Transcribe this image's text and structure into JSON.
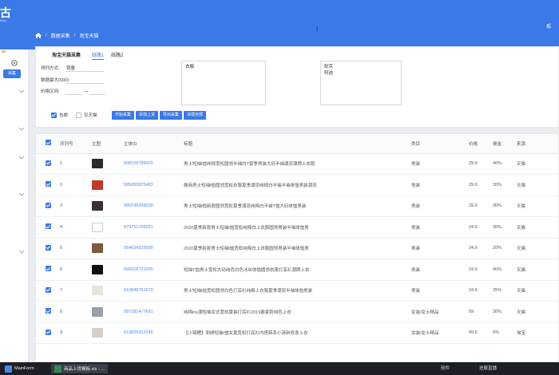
{
  "brand": {
    "logo": "古",
    "sub": "ding"
  },
  "top_right": "孤",
  "breadcrumb": [
    "数据采集",
    "淘宝天猫"
  ],
  "sidebar": {
    "active_label": "采集"
  },
  "tabs": {
    "main": "淘宝天猫采集",
    "t1": "线路1",
    "t2": "线路2"
  },
  "form": {
    "sort_label": "排列方式:",
    "sort_value": "销量",
    "max_label": "数据最大(500):",
    "price_label": "价格区间:",
    "price_sep": "—",
    "keywords": "衣服",
    "notes_line1": "耐克",
    "notes_line2": "阿迪"
  },
  "options": {
    "baoyou": "包邮",
    "tmall_only": "仅天猫"
  },
  "buttons": [
    "开始采集",
    "添加上货",
    "导出采集",
    "清理全部"
  ],
  "table": {
    "headers": [
      "序列号",
      "主图",
      "主体ID",
      "标题",
      "类目",
      "价格",
      "佣金",
      "来源"
    ],
    "rows": [
      {
        "n": "1",
        "id": "608109785003",
        "title": "男士短袖t恤纯棉宽松圆领半袖白T夏季男装大码半袖潮流潮牌上衣服",
        "cat": "男装",
        "price": "29.9",
        "comm": "40%",
        "src": "天猫",
        "img": "#2b2b2b"
      },
      {
        "n": "2",
        "id": "585055525483",
        "title": "微商男士短袖t恤圆领宽松衣服夏季潮流纯棉白半袖半袖体恤男装潮流",
        "cat": "男装",
        "price": "29.9",
        "comm": "30%",
        "src": "天猫",
        "img": "#c0392b"
      },
      {
        "n": "3",
        "id": "585038308339",
        "title": "男士短袖t恤新款圆领宽松夏季潮流纯棉白半袖T恤大码体恤男装",
        "cat": "男装",
        "price": "29.9",
        "comm": "30%",
        "src": "天猫",
        "img": "#3b2f2f"
      },
      {
        "n": "4",
        "id": "579751705261",
        "title": "2020夏季新款男士短袖t恤宽松纯棉白上衣服圆领男装半袖体恤男",
        "cat": "男装",
        "price": "24.9",
        "comm": "30%",
        "src": "天猫",
        "img": "#ffffff"
      },
      {
        "n": "5",
        "id": "564624315990",
        "title": "2020夏季新款男士短袖t恤宽松纯棉白上衣服圆领男装半袖体恤男",
        "cat": "男装",
        "price": "24.9",
        "comm": "20%",
        "src": "天猫",
        "img": "#7a5a3a"
      },
      {
        "n": "6",
        "id": "565016721025",
        "title": "短袖T恤男士宽松大码纯色白色冰丝体恤圆领衣服打底衫潮牌上衣",
        "cat": "男装",
        "price": "19.9",
        "comm": "40%",
        "src": "天猫",
        "img": "#111111"
      },
      {
        "n": "7",
        "id": "610845761670",
        "title": "男士短袖t恤宽松圆领白色打底衫纯棉上衣服夏季潮流半袖体恤男装",
        "cat": "男装",
        "price": "24.9",
        "comm": "25%",
        "src": "天猫",
        "img": "#e8e4dc"
      },
      {
        "n": "8",
        "id": "587281477691",
        "title": "纯棉ins潮短袖女式宽松夏装打底衫2019春夏款纯色上衣",
        "cat": "女装/女士精品",
        "price": "59",
        "comm": "30%",
        "src": "天猫",
        "img": "#9aa0a8"
      },
      {
        "n": "9",
        "id": "613605312245",
        "title": "【小锦鲤】刺绣短袖t恤女夏宽松打底衫内搭韩系小清新修身上衣",
        "cat": "女装/女士精品",
        "price": "49.5",
        "comm": "6%",
        "src": "淘宝",
        "img": "#d6d0c8"
      }
    ]
  },
  "taskbar": {
    "app1": "MainForm",
    "app2": "商品上货模板.xls - ...",
    "tray1": "软件",
    "tray2": "进展直播"
  }
}
